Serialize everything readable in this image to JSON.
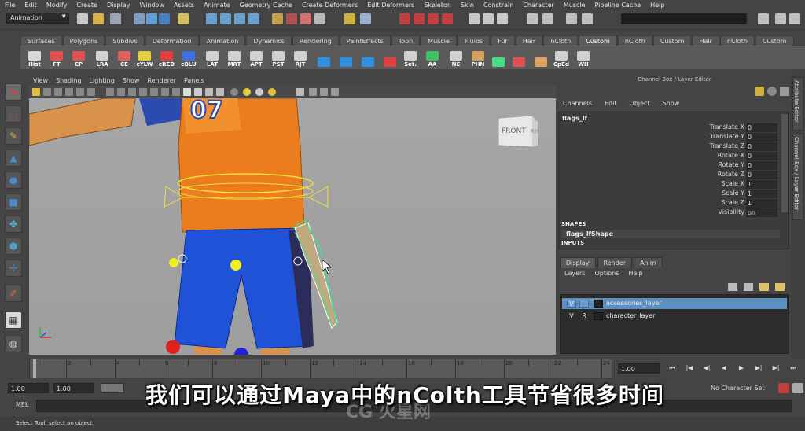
{
  "menubar": [
    "File",
    "Edit",
    "Modify",
    "Create",
    "Display",
    "Window",
    "Assets",
    "Animate",
    "Geometry Cache",
    "Create Deformers",
    "Edit Deformers",
    "Skeleton",
    "Skin",
    "Constrain",
    "Character",
    "Muscle",
    "Pipeline Cache",
    "Help"
  ],
  "status": {
    "mode": "Animation"
  },
  "shelf_tabs": [
    "Surfaces",
    "Polygons",
    "Subdivs",
    "Deformation",
    "Animation",
    "Dynamics",
    "Rendering",
    "PaintEffects",
    "Toon",
    "Muscle",
    "Fluids",
    "Fur",
    "Hair",
    "nCloth",
    "Custom",
    "nCloth",
    "Custom",
    "Hair",
    "nCloth",
    "Custom"
  ],
  "shelf_buttons": [
    "Hist",
    "FT",
    "CP",
    "LRA",
    "CE",
    "cYLW",
    "cRED",
    "cBLU",
    "LAT",
    "MRT",
    "APT",
    "PST",
    "RJT",
    "",
    "",
    "",
    "",
    "Set.",
    "AA",
    "NE",
    "PHN",
    "",
    "",
    "",
    "CpEd",
    "WH"
  ],
  "viewport": {
    "menu": [
      "View",
      "Shading",
      "Lighting",
      "Show",
      "Renderer",
      "Panels"
    ],
    "viewcube_front": "FRONT",
    "viewcube_side": "RH",
    "jersey_number": "07"
  },
  "channel_box": {
    "header": "Channel Box / Layer Editor",
    "menu": [
      "Channels",
      "Edit",
      "Object",
      "Show"
    ],
    "object_name": "flags_lf",
    "attributes": [
      {
        "name": "Translate X",
        "value": "0"
      },
      {
        "name": "Translate Y",
        "value": "0"
      },
      {
        "name": "Translate Z",
        "value": "0"
      },
      {
        "name": "Rotate X",
        "value": "0"
      },
      {
        "name": "Rotate Y",
        "value": "0"
      },
      {
        "name": "Rotate Z",
        "value": "0"
      },
      {
        "name": "Scale X",
        "value": "1"
      },
      {
        "name": "Scale Y",
        "value": "1"
      },
      {
        "name": "Scale Z",
        "value": "1"
      },
      {
        "name": "Visibility",
        "value": "on"
      }
    ],
    "shapes_title": "SHAPES",
    "shape_name": "flags_lfShape",
    "inputs_title": "INPUTS"
  },
  "layer_editor": {
    "tabs": [
      "Display",
      "Render",
      "Anim"
    ],
    "menu": [
      "Layers",
      "Options",
      "Help"
    ],
    "layers": [
      {
        "v": "V",
        "r": "",
        "name": "accessories_layer",
        "selected": true
      },
      {
        "v": "V",
        "r": "R",
        "name": "character_layer",
        "selected": false
      }
    ]
  },
  "side_tabs": [
    "Attribute Editor",
    "Channel Box / Layer Editor"
  ],
  "timeline": {
    "ticks": [
      "2",
      "4",
      "6",
      "8",
      "10",
      "12",
      "14",
      "16",
      "18",
      "20",
      "22",
      "24"
    ],
    "current": "1.00"
  },
  "range": {
    "start": "1.00",
    "start2": "1.00",
    "character_set": "No Character Set"
  },
  "command": {
    "label": "MEL"
  },
  "help_line": "Select Tool: select an object",
  "subtitle": "我们可以通过Maya中的nColth工具节省很多时间",
  "watermark": "CG 火星网"
}
